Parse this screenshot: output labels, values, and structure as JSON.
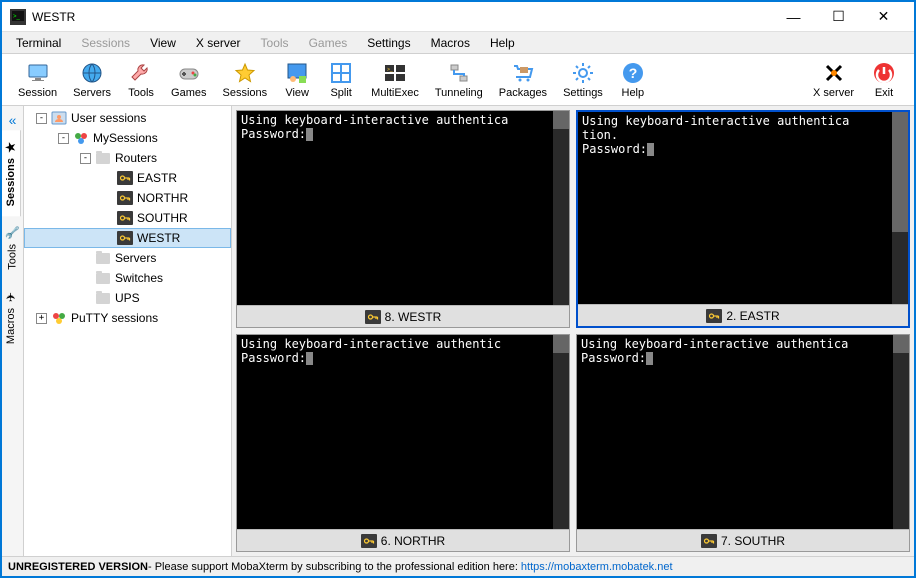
{
  "title": "WESTR",
  "menu": [
    "Terminal",
    "Sessions",
    "View",
    "X server",
    "Tools",
    "Games",
    "Settings",
    "Macros",
    "Help"
  ],
  "menu_disabled": [
    1,
    4,
    5
  ],
  "toolbar": [
    {
      "label": "Session",
      "icon": "monitor"
    },
    {
      "label": "Servers",
      "icon": "globe"
    },
    {
      "label": "Tools",
      "icon": "wrench"
    },
    {
      "label": "Games",
      "icon": "gamepad"
    },
    {
      "label": "Sessions",
      "icon": "star"
    },
    {
      "label": "View",
      "icon": "view"
    },
    {
      "label": "Split",
      "icon": "split"
    },
    {
      "label": "MultiExec",
      "icon": "multiexec"
    },
    {
      "label": "Tunneling",
      "icon": "tunnel"
    },
    {
      "label": "Packages",
      "icon": "packages"
    },
    {
      "label": "Settings",
      "icon": "gear"
    },
    {
      "label": "Help",
      "icon": "help"
    }
  ],
  "toolbar_right": [
    {
      "label": "X server",
      "icon": "xserver"
    },
    {
      "label": "Exit",
      "icon": "exit"
    }
  ],
  "sidetabs": [
    {
      "label": "Sessions",
      "icon": "★",
      "active": true
    },
    {
      "label": "Tools",
      "icon": "🔧",
      "active": false
    },
    {
      "label": "Macros",
      "icon": "✈",
      "active": false
    }
  ],
  "tree": [
    {
      "depth": 0,
      "toggle": "-",
      "icon": "usersessions",
      "label": "User sessions"
    },
    {
      "depth": 1,
      "toggle": "-",
      "icon": "mysessions",
      "label": "MySessions"
    },
    {
      "depth": 2,
      "toggle": "-",
      "icon": "folder",
      "label": "Routers"
    },
    {
      "depth": 3,
      "toggle": "",
      "icon": "key",
      "label": "EASTR"
    },
    {
      "depth": 3,
      "toggle": "",
      "icon": "key",
      "label": "NORTHR"
    },
    {
      "depth": 3,
      "toggle": "",
      "icon": "key",
      "label": "SOUTHR"
    },
    {
      "depth": 3,
      "toggle": "",
      "icon": "key",
      "label": "WESTR",
      "selected": true
    },
    {
      "depth": 2,
      "toggle": "",
      "icon": "folder",
      "label": "Servers"
    },
    {
      "depth": 2,
      "toggle": "",
      "icon": "folder",
      "label": "Switches"
    },
    {
      "depth": 2,
      "toggle": "",
      "icon": "folder",
      "label": "UPS"
    },
    {
      "depth": 0,
      "toggle": "+",
      "icon": "putty",
      "label": "PuTTY sessions"
    }
  ],
  "terminals": [
    {
      "tab": "8. WESTR",
      "lines": [
        "Using keyboard-interactive authentica",
        "Password:"
      ],
      "active": false,
      "scroll_thumb": {
        "top": 0,
        "h": 18
      }
    },
    {
      "tab": "2. EASTR",
      "lines": [
        "Using keyboard-interactive authentica",
        "tion.",
        "Password:"
      ],
      "active": true,
      "scroll_thumb": {
        "top": 0,
        "h": 120
      }
    },
    {
      "tab": "6. NORTHR",
      "lines": [
        "Using keyboard-interactive authentic",
        "Password:"
      ],
      "active": false,
      "scroll_thumb": {
        "top": 0,
        "h": 18
      }
    },
    {
      "tab": "7. SOUTHR",
      "lines": [
        "Using keyboard-interactive authentica",
        "Password:"
      ],
      "active": false,
      "scroll_thumb": {
        "top": 0,
        "h": 18
      }
    }
  ],
  "status": {
    "unreg": "UNREGISTERED VERSION",
    "msg": " -  Please support MobaXterm by subscribing to the professional edition here: ",
    "link": "https://mobaxterm.mobatek.net"
  }
}
